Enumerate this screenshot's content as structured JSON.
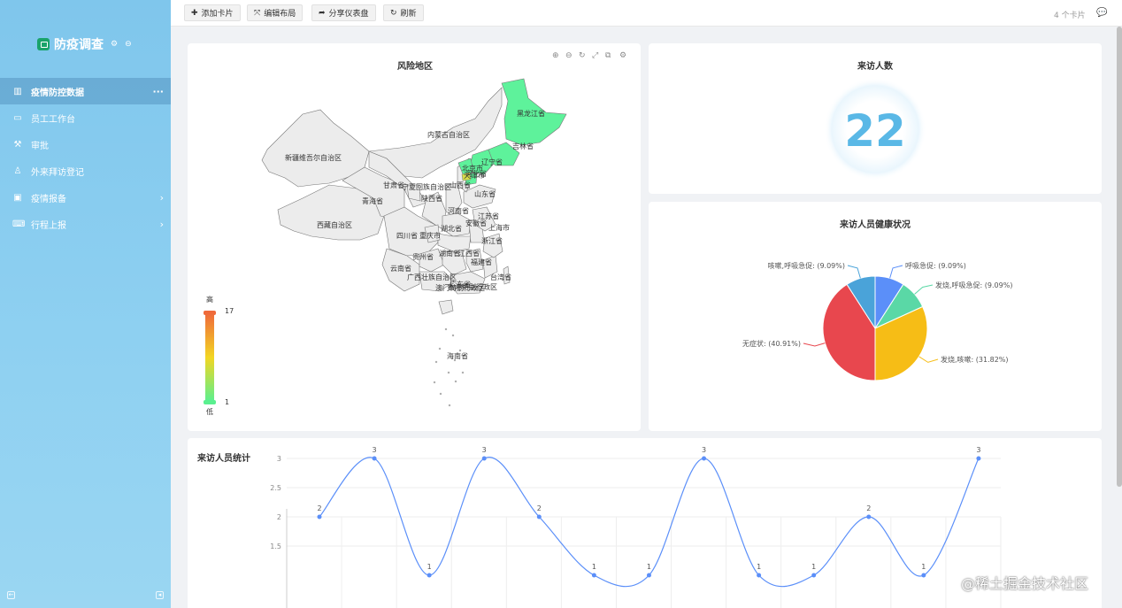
{
  "sidebar": {
    "brand": "防疫调查",
    "items": [
      {
        "label": "疫情防控数据",
        "icon": "bar-chart-icon",
        "active": true,
        "right": "···"
      },
      {
        "label": "员工工作台",
        "icon": "desktop-icon",
        "active": false,
        "right": ""
      },
      {
        "label": "审批",
        "icon": "gavel-icon",
        "active": false,
        "right": ""
      },
      {
        "label": "外来拜访登记",
        "icon": "person-icon",
        "active": false,
        "right": ""
      },
      {
        "label": "疫情报备",
        "icon": "briefcase-icon",
        "active": false,
        "right": "›"
      },
      {
        "label": "行程上报",
        "icon": "keyboard-icon",
        "active": false,
        "right": "›"
      }
    ]
  },
  "toolbar": {
    "add": "添加卡片",
    "layout": "编辑布局",
    "share": "分享仪表盘",
    "refresh": "刷新",
    "card_count": "4 个卡片"
  },
  "map": {
    "title": "风险地区",
    "legend_high": "高",
    "legend_low": "低",
    "legend_max": "17",
    "legend_min": "1",
    "regions": [
      "新疆维吾尔自治区",
      "西藏自治区",
      "青海省",
      "甘肃省",
      "内蒙古自治区",
      "黑龙江省",
      "吉林省",
      "辽宁省",
      "北京市",
      "天津市",
      "河北省",
      "山西省",
      "山东省",
      "宁夏回族自治区",
      "陕西省",
      "河南省",
      "江苏省",
      "安徽省",
      "上海市",
      "湖北省",
      "浙江省",
      "四川省",
      "重庆市",
      "贵州省",
      "湖南省",
      "江西省",
      "福建省",
      "云南省",
      "广西壮族自治区",
      "广东省",
      "台湾省",
      "海南省",
      "香港特别行政区",
      "澳门特别行政区"
    ]
  },
  "visitors": {
    "title": "来访人数",
    "count": "22"
  },
  "health": {
    "title": "来访人员健康状况",
    "chart_data": {
      "type": "pie",
      "slices": [
        {
          "label": "呼吸急促: (9.09%)",
          "value": 9.09,
          "color": "#5b8ff9"
        },
        {
          "label": "发烧,呼吸急促: (9.09%)",
          "value": 9.09,
          "color": "#5ad8a6"
        },
        {
          "label": "发烧,咳嗽: (31.82%)",
          "value": 31.82,
          "color": "#f6bd16"
        },
        {
          "label": "无症状: (40.91%)",
          "value": 40.91,
          "color": "#e8474e"
        },
        {
          "label": "咳嗽,呼吸急促: (9.09%)",
          "value": 9.09,
          "color": "#4aa3d9"
        }
      ]
    }
  },
  "stats": {
    "title": "来访人员统计",
    "chart_data": {
      "type": "line",
      "points": [
        {
          "x": 0,
          "y": 2
        },
        {
          "x": 1,
          "y": 3
        },
        {
          "x": 2,
          "y": 1
        },
        {
          "x": 3,
          "y": 3
        },
        {
          "x": 4,
          "y": 2
        },
        {
          "x": 5,
          "y": 1
        },
        {
          "x": 6,
          "y": 1
        },
        {
          "x": 7,
          "y": 3
        },
        {
          "x": 8,
          "y": 1
        },
        {
          "x": 9,
          "y": 1
        },
        {
          "x": 10,
          "y": 2
        },
        {
          "x": 11,
          "y": 1
        },
        {
          "x": 12,
          "y": 3
        }
      ],
      "y_ticks": [
        "3",
        "2.5",
        "2",
        "1.5"
      ],
      "ylim": [
        1,
        3
      ],
      "grid": true,
      "color": "#5b8ff9"
    }
  },
  "watermark": "@稀土掘金技术社区"
}
